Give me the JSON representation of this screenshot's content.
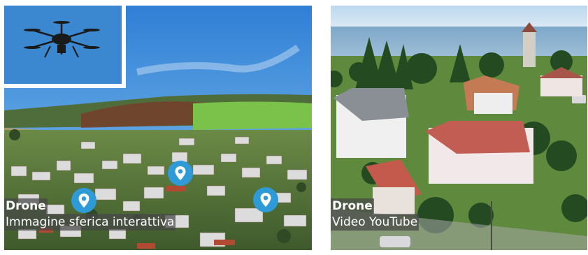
{
  "cards": [
    {
      "title": "Drone",
      "subtitle": "Immagine sferica interattiva",
      "icons": [
        "drone-icon",
        "map-pin-icon"
      ]
    },
    {
      "title": "Drone",
      "subtitle": "Video YouTube"
    }
  ],
  "colors": {
    "sky": "#5ea3df",
    "pin": "#2e9ad8",
    "caption_bg": "#464646",
    "caption_text": "#ffffff"
  }
}
